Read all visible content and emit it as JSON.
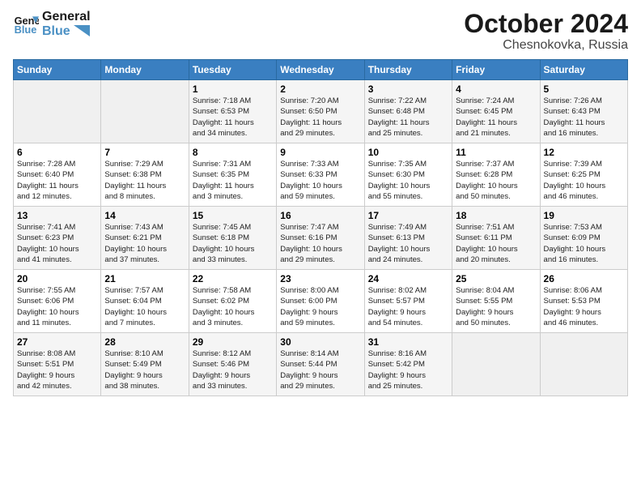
{
  "header": {
    "logo_line1": "General",
    "logo_line2": "Blue",
    "month_title": "October 2024",
    "subtitle": "Chesnokovka, Russia"
  },
  "weekdays": [
    "Sunday",
    "Monday",
    "Tuesday",
    "Wednesday",
    "Thursday",
    "Friday",
    "Saturday"
  ],
  "weeks": [
    [
      {
        "day": "",
        "info": ""
      },
      {
        "day": "",
        "info": ""
      },
      {
        "day": "1",
        "info": "Sunrise: 7:18 AM\nSunset: 6:53 PM\nDaylight: 11 hours\nand 34 minutes."
      },
      {
        "day": "2",
        "info": "Sunrise: 7:20 AM\nSunset: 6:50 PM\nDaylight: 11 hours\nand 29 minutes."
      },
      {
        "day": "3",
        "info": "Sunrise: 7:22 AM\nSunset: 6:48 PM\nDaylight: 11 hours\nand 25 minutes."
      },
      {
        "day": "4",
        "info": "Sunrise: 7:24 AM\nSunset: 6:45 PM\nDaylight: 11 hours\nand 21 minutes."
      },
      {
        "day": "5",
        "info": "Sunrise: 7:26 AM\nSunset: 6:43 PM\nDaylight: 11 hours\nand 16 minutes."
      }
    ],
    [
      {
        "day": "6",
        "info": "Sunrise: 7:28 AM\nSunset: 6:40 PM\nDaylight: 11 hours\nand 12 minutes."
      },
      {
        "day": "7",
        "info": "Sunrise: 7:29 AM\nSunset: 6:38 PM\nDaylight: 11 hours\nand 8 minutes."
      },
      {
        "day": "8",
        "info": "Sunrise: 7:31 AM\nSunset: 6:35 PM\nDaylight: 11 hours\nand 3 minutes."
      },
      {
        "day": "9",
        "info": "Sunrise: 7:33 AM\nSunset: 6:33 PM\nDaylight: 10 hours\nand 59 minutes."
      },
      {
        "day": "10",
        "info": "Sunrise: 7:35 AM\nSunset: 6:30 PM\nDaylight: 10 hours\nand 55 minutes."
      },
      {
        "day": "11",
        "info": "Sunrise: 7:37 AM\nSunset: 6:28 PM\nDaylight: 10 hours\nand 50 minutes."
      },
      {
        "day": "12",
        "info": "Sunrise: 7:39 AM\nSunset: 6:25 PM\nDaylight: 10 hours\nand 46 minutes."
      }
    ],
    [
      {
        "day": "13",
        "info": "Sunrise: 7:41 AM\nSunset: 6:23 PM\nDaylight: 10 hours\nand 41 minutes."
      },
      {
        "day": "14",
        "info": "Sunrise: 7:43 AM\nSunset: 6:21 PM\nDaylight: 10 hours\nand 37 minutes."
      },
      {
        "day": "15",
        "info": "Sunrise: 7:45 AM\nSunset: 6:18 PM\nDaylight: 10 hours\nand 33 minutes."
      },
      {
        "day": "16",
        "info": "Sunrise: 7:47 AM\nSunset: 6:16 PM\nDaylight: 10 hours\nand 29 minutes."
      },
      {
        "day": "17",
        "info": "Sunrise: 7:49 AM\nSunset: 6:13 PM\nDaylight: 10 hours\nand 24 minutes."
      },
      {
        "day": "18",
        "info": "Sunrise: 7:51 AM\nSunset: 6:11 PM\nDaylight: 10 hours\nand 20 minutes."
      },
      {
        "day": "19",
        "info": "Sunrise: 7:53 AM\nSunset: 6:09 PM\nDaylight: 10 hours\nand 16 minutes."
      }
    ],
    [
      {
        "day": "20",
        "info": "Sunrise: 7:55 AM\nSunset: 6:06 PM\nDaylight: 10 hours\nand 11 minutes."
      },
      {
        "day": "21",
        "info": "Sunrise: 7:57 AM\nSunset: 6:04 PM\nDaylight: 10 hours\nand 7 minutes."
      },
      {
        "day": "22",
        "info": "Sunrise: 7:58 AM\nSunset: 6:02 PM\nDaylight: 10 hours\nand 3 minutes."
      },
      {
        "day": "23",
        "info": "Sunrise: 8:00 AM\nSunset: 6:00 PM\nDaylight: 9 hours\nand 59 minutes."
      },
      {
        "day": "24",
        "info": "Sunrise: 8:02 AM\nSunset: 5:57 PM\nDaylight: 9 hours\nand 54 minutes."
      },
      {
        "day": "25",
        "info": "Sunrise: 8:04 AM\nSunset: 5:55 PM\nDaylight: 9 hours\nand 50 minutes."
      },
      {
        "day": "26",
        "info": "Sunrise: 8:06 AM\nSunset: 5:53 PM\nDaylight: 9 hours\nand 46 minutes."
      }
    ],
    [
      {
        "day": "27",
        "info": "Sunrise: 8:08 AM\nSunset: 5:51 PM\nDaylight: 9 hours\nand 42 minutes."
      },
      {
        "day": "28",
        "info": "Sunrise: 8:10 AM\nSunset: 5:49 PM\nDaylight: 9 hours\nand 38 minutes."
      },
      {
        "day": "29",
        "info": "Sunrise: 8:12 AM\nSunset: 5:46 PM\nDaylight: 9 hours\nand 33 minutes."
      },
      {
        "day": "30",
        "info": "Sunrise: 8:14 AM\nSunset: 5:44 PM\nDaylight: 9 hours\nand 29 minutes."
      },
      {
        "day": "31",
        "info": "Sunrise: 8:16 AM\nSunset: 5:42 PM\nDaylight: 9 hours\nand 25 minutes."
      },
      {
        "day": "",
        "info": ""
      },
      {
        "day": "",
        "info": ""
      }
    ]
  ]
}
